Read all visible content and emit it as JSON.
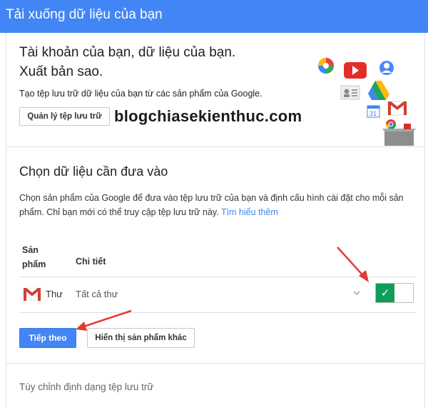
{
  "header": {
    "title": "Tải xuống dữ liệu của bạn"
  },
  "intro": {
    "headline_line1": "Tài khoản của bạn, dữ liệu của bạn.",
    "headline_line2": "Xuất bản sao.",
    "description": "Tạo tệp lưu trữ dữ liệu của bạn từ các sản phẩm của Google.",
    "manage_button": "Quản lý tệp lưu trữ",
    "watermark": "blogchiasekienthuc.com"
  },
  "select_section": {
    "title": "Chọn dữ liệu cần đưa vào",
    "description": "Chọn sản phẩm của Google để đưa vào tệp lưu trữ của bạn và định cấu hình cài đặt cho mỗi sản phẩm. Chỉ bạn mới có thể truy cập tệp lưu trữ này.",
    "learn_more": "Tìm hiểu thêm",
    "columns": {
      "product": "Sản phẩm",
      "detail": "Chi tiết"
    },
    "rows": [
      {
        "icon": "gmail-icon",
        "product": "Thư",
        "detail": "Tất cả thư",
        "enabled": true
      }
    ],
    "next_button": "Tiếp theo",
    "more_products_button": "Hiển thị sản phẩm khác"
  },
  "format_section": {
    "title": "Tùy chỉnh định dạng tệp lưu trữ"
  },
  "icons": [
    "picasa-icon",
    "youtube-icon",
    "profile-icon",
    "contacts-icon",
    "drive-icon",
    "calendar-icon",
    "gmail-icon",
    "chrome-icon",
    "archive-box-icon"
  ],
  "colors": {
    "header": "#4285f4",
    "toggle_on": "#109d58",
    "primary_button": "#4285f4",
    "link": "#4285f4",
    "arrow": "#e53935"
  }
}
